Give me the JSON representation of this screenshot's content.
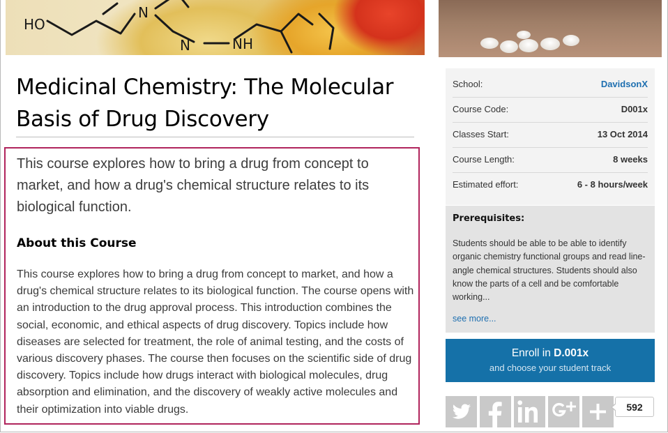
{
  "course": {
    "title": "Medicinal Chemistry: The Molecular Basis of Drug Discovery",
    "lead": "This course explores how to bring a drug from concept to market, and how a drug's chemical structure relates to its biological function.",
    "about_heading": "About this Course",
    "about_body": "This course explores how to bring a drug from concept to market, and how a drug's chemical structure relates to its biological function. The course opens with an introduction to the drug approval process. This introduction combines the social, economic, and ethical aspects of drug discovery. Topics include how diseases are selected for treatment, the role of animal testing, and the costs of various discovery phases. The course then focuses on the scientific side of drug discovery. Topics include how drugs interact with biological molecules, drug absorption and elimination, and the discovery of weakly active molecules and their optimization into viable drugs."
  },
  "hero": {
    "molecule_labels": [
      "HO",
      "N",
      "N",
      "NH"
    ]
  },
  "info": {
    "school_label": "School:",
    "school_value": "DavidsonX",
    "code_label": "Course Code:",
    "code_value": "D001x",
    "start_label": "Classes Start:",
    "start_value": "13 Oct 2014",
    "length_label": "Course Length:",
    "length_value": "8 weeks",
    "effort_label": "Estimated effort:",
    "effort_value": "6 - 8 hours/week"
  },
  "prerequisites": {
    "heading": "Prerequisites:",
    "text": "Students should be able to be able to identify organic chemistry functional groups and read line-angle chemical structures. Students should also know the parts of a cell and be comfortable working...",
    "see_more": "see more..."
  },
  "enroll": {
    "prefix": "Enroll in ",
    "code": "D.001x",
    "subtitle": "and choose your student track"
  },
  "share": {
    "icons": [
      "twitter-icon",
      "facebook-icon",
      "linkedin-icon",
      "google-plus-icon",
      "plus-icon"
    ],
    "count": "592"
  },
  "colors": {
    "link": "#1e6fb0",
    "enroll_bg": "#1571a8",
    "highlight_border": "#b0245c",
    "share_tile": "#c9c9c9"
  }
}
